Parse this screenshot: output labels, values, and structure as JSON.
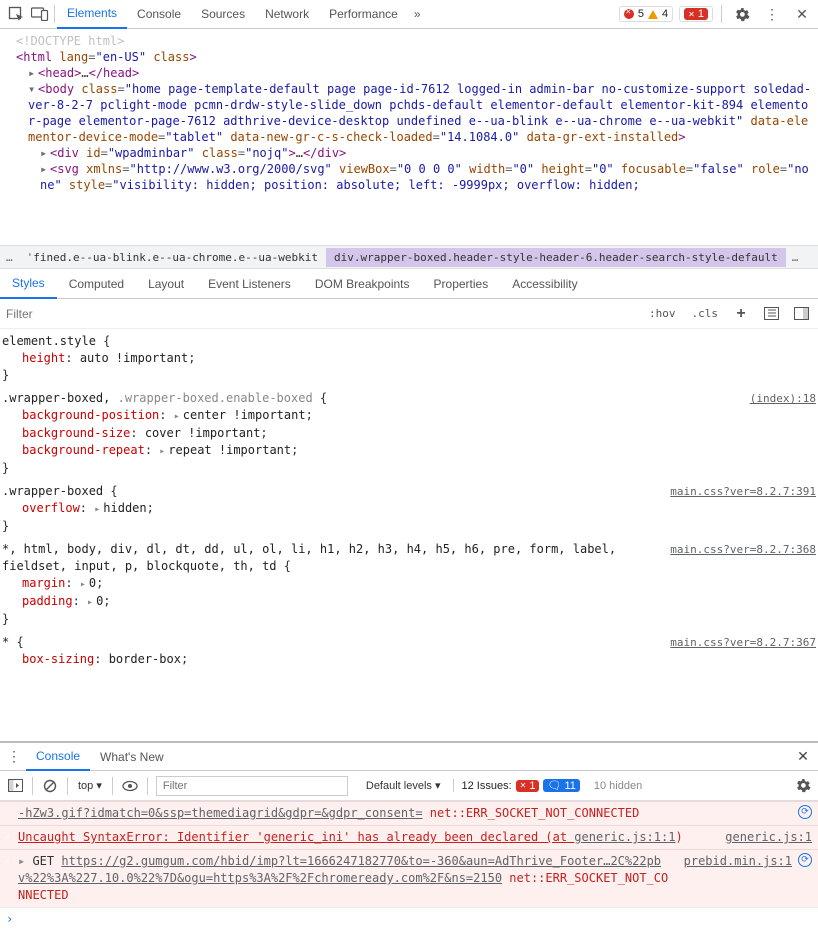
{
  "topTabs": [
    "Elements",
    "Console",
    "Sources",
    "Network",
    "Performance"
  ],
  "topTabActive": 0,
  "errorCount": "5",
  "warnCount": "4",
  "issueErrorBadge": "1",
  "dom": {
    "doctype": "<!DOCTYPE html>",
    "htmlOpen": "<html lang=\"en-US\" class>",
    "headCollapsed": "<head>…</head>",
    "bodyOpen": "<body class=\"home page-template-default page page-id-7612 logged-in admin-bar no-customize-support soledad-ver-8-2-7 pclight-mode pcmn-drdw-style-slide_down pchds-default elementor-default elementor-kit-894 elementor-page elementor-page-7612 adthrive-device-desktop undefined e--ua-blink e--ua-chrome e--ua-webkit\" data-elementor-device-mode=\"tablet\" data-new-gr-c-s-check-loaded=\"14.1084.0\" data-gr-ext-installed>",
    "divAdmin": "<div id=\"wpadminbar\" class=\"nojq\">…</div>",
    "svgLine": "<svg xmlns=\"http://www.w3.org/2000/svg\" viewBox=\"0 0 0 0\" width=\"0\" height=\"0\" focusable=\"false\" role=\"none\" style=\"visibility: hidden; position: absolute; left: -9999px; overflow: hidden;"
  },
  "breadcrumb": {
    "truncLeft": "ˈfined.e--ua-blink.e--ua-chrome.e--ua-webkit",
    "selected": "div.wrapper-boxed.header-style-header-6.header-search-style-default"
  },
  "secTabs": [
    "Styles",
    "Computed",
    "Layout",
    "Event Listeners",
    "DOM Breakpoints",
    "Properties",
    "Accessibility"
  ],
  "secTabActive": 0,
  "filter": {
    "placeholder": "Filter",
    "hov": ":hov",
    "cls": ".cls"
  },
  "rules": [
    {
      "selector": "element.style",
      "src": "",
      "props": [
        [
          "height",
          "auto !important"
        ]
      ]
    },
    {
      "selector": ".wrapper-boxed,",
      "inactive": ".wrapper-boxed.enable-boxed",
      "src": "(index):18",
      "props": [
        [
          "background-position",
          "center !important",
          "arrow"
        ],
        [
          "background-size",
          "cover !important"
        ],
        [
          "background-repeat",
          "repeat !important",
          "arrow"
        ]
      ]
    },
    {
      "selector": ".wrapper-boxed",
      "src": "main.css?ver=8.2.7:391",
      "props": [
        [
          "overflow",
          "hidden",
          "arrow"
        ]
      ]
    },
    {
      "selector": "*, html, body, div, dl, dt, dd, ul, ol, li, h1, h2, h3, h4, h5, h6, pre, form, label, fieldset, input, p, blockquote, th, td",
      "src": "main.css?ver=8.2.7:368",
      "wraps": true,
      "props": [
        [
          "margin",
          "0",
          "arrow"
        ],
        [
          "padding",
          "0",
          "arrow"
        ]
      ]
    },
    {
      "selector": "*",
      "src": "main.css?ver=8.2.7:367",
      "props": [
        [
          "box-sizing",
          "border-box"
        ]
      ],
      "cutoff": true
    }
  ],
  "drawer": {
    "tabs": [
      "Console",
      "What's New"
    ],
    "active": 0
  },
  "consoleFilter": {
    "context": "top ▾",
    "inputPlaceholder": "Filter",
    "levels": "Default levels ▾",
    "issuesLabel": "12 Issues:",
    "issuesErr": "1",
    "issuesInfo": "11",
    "hidden": "10 hidden"
  },
  "consoleMsgs": [
    {
      "type": "err-cont",
      "pre": "-hZw3.gif?idmatch=0&ssp=themediagrid&gdpr=&gdpr_consent=",
      "err": " net::ERR_SOCKET_NOT_CONNECTED",
      "origin": "",
      "showRefresh": true
    },
    {
      "type": "err",
      "pre": "Uncaught SyntaxError: Identifier 'generic_ini' has already been declared (at ",
      "linkText": "generic.js:1:1",
      "post": ")",
      "origin": "generic.js:1"
    },
    {
      "type": "err",
      "arrow": true,
      "method": "GET",
      "url": "https://g2.gumgum.com/hbid/imp?lt=1666247182770&to=-360&aun=AdThrive_Footer…2C%22pbv%22%3A%227.10.0%22%7D&ogu=https%3A%2F%2Fchromeready.com%2F&ns=2150",
      "err": " net::ERR_SOCKET_NOT_CONNECTED",
      "origin": "prebid.min.js:1",
      "showRefresh": true
    }
  ]
}
